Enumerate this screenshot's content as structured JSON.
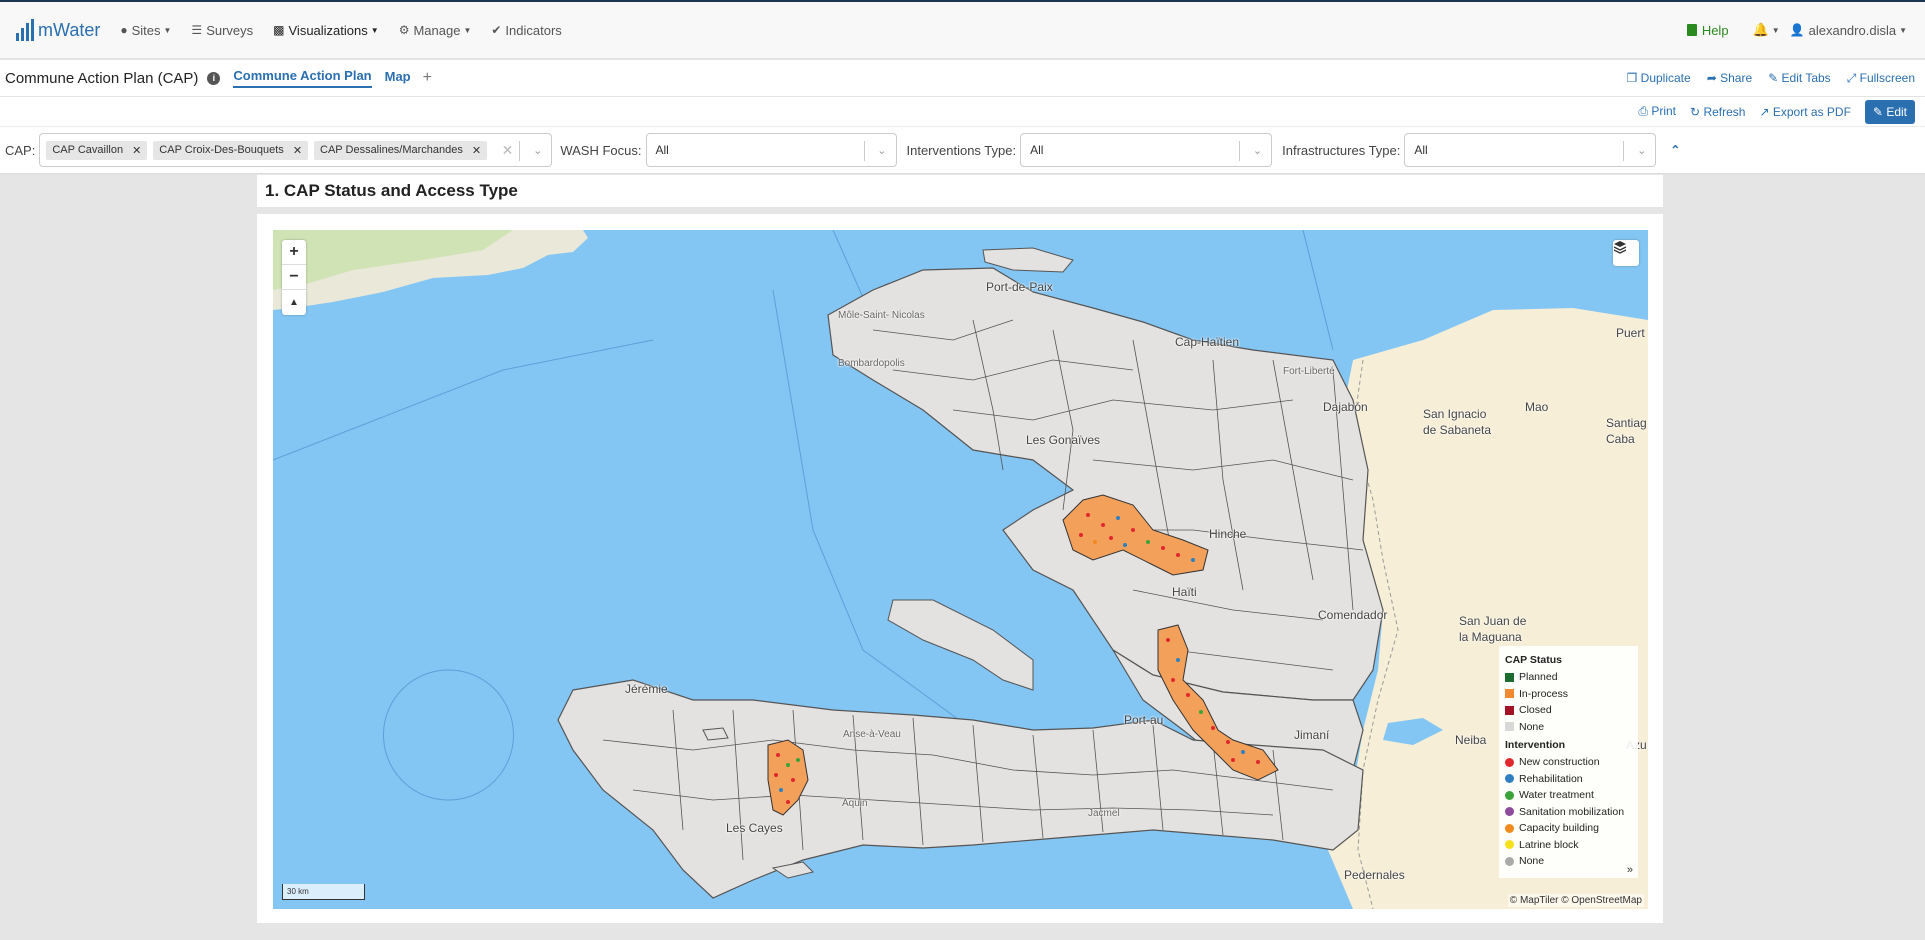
{
  "brand": {
    "name": "mWater"
  },
  "nav": {
    "items": [
      {
        "label": "Sites",
        "icon": "map-marker-icon",
        "dropdown": true
      },
      {
        "label": "Surveys",
        "icon": "list-icon",
        "dropdown": false
      },
      {
        "label": "Visualizations",
        "icon": "bar-chart-icon",
        "dropdown": true
      },
      {
        "label": "Manage",
        "icon": "gear-icon",
        "dropdown": true
      },
      {
        "label": "Indicators",
        "icon": "check-circle-icon",
        "dropdown": false
      }
    ],
    "help": "Help",
    "user": "alexandro.disla"
  },
  "dashboard": {
    "title": "Commune Action Plan (CAP)",
    "tabs": [
      "Commune Action Plan",
      "Map"
    ],
    "actions": [
      "Duplicate",
      "Share",
      "Edit Tabs",
      "Fullscreen"
    ],
    "toolbar": [
      "Print",
      "Refresh",
      "Export as PDF"
    ],
    "edit": "Edit"
  },
  "filters": {
    "cap": {
      "label": "CAP:",
      "chips": [
        "CAP Cavaillon",
        "CAP Croix-Des-Bouquets",
        "CAP Dessalines/Marchandes"
      ]
    },
    "wash": {
      "label": "WASH Focus:",
      "value": "All"
    },
    "interventions": {
      "label": "Interventions Type:",
      "value": "All"
    },
    "infrastructures": {
      "label": "Infrastructures Type:",
      "value": "All"
    }
  },
  "section": {
    "title": "1. CAP Status and Access Type"
  },
  "map": {
    "scale": "30 km",
    "attribution": "© MapTiler © OpenStreetMap",
    "labels": {
      "port_de_paix": "Port-de-Paix",
      "mole": "Môle-Saint-\nNicolas",
      "bombardopolis": "Bombardopolis",
      "cap_haitien": "Cap-Haïtien",
      "fort_liberte": "Fort-Liberté",
      "dajabon": "Dajabón",
      "san_ignacio": "San Ignacio\nde Sabaneta",
      "mao": "Mao",
      "santiago": "Santiag\nCaba",
      "puerto": "Puert",
      "gonaives": "Les Gonaïves",
      "hinche": "Hinche",
      "haiti": "Haïti",
      "comendador": "Comendador",
      "san_juan": "San Juan de\nla Maguana",
      "jeremie": "Jérémie",
      "anse_a_veau": "Anse-à-Veau",
      "port_au_prince": "Port-au",
      "jimani": "Jimaní",
      "neiba": "Neiba",
      "azua": "Azu",
      "aquin": "Aquin",
      "les_cayes": "Les Cayes",
      "jacmel": "Jacmel",
      "pedernales": "Pedernales"
    }
  },
  "legend": {
    "status_title": "CAP Status",
    "status": [
      {
        "label": "Planned",
        "color": "#1e6b2e"
      },
      {
        "label": "In-process",
        "color": "#f08a30"
      },
      {
        "label": "Closed",
        "color": "#a01224"
      },
      {
        "label": "None",
        "color": "#d8d8d8"
      }
    ],
    "intervention_title": "Intervention",
    "interventions": [
      {
        "label": "New construction",
        "color": "#e0282e"
      },
      {
        "label": "Rehabilitation",
        "color": "#2f7fc1"
      },
      {
        "label": "Water treatment",
        "color": "#3aa43a"
      },
      {
        "label": "Sanitation mobilization",
        "color": "#8e4a9c"
      },
      {
        "label": "Capacity building",
        "color": "#f28a1e"
      },
      {
        "label": "Latrine block",
        "color": "#f5e11c"
      },
      {
        "label": "None",
        "color": "#aaaaaa"
      }
    ],
    "more": "»"
  }
}
